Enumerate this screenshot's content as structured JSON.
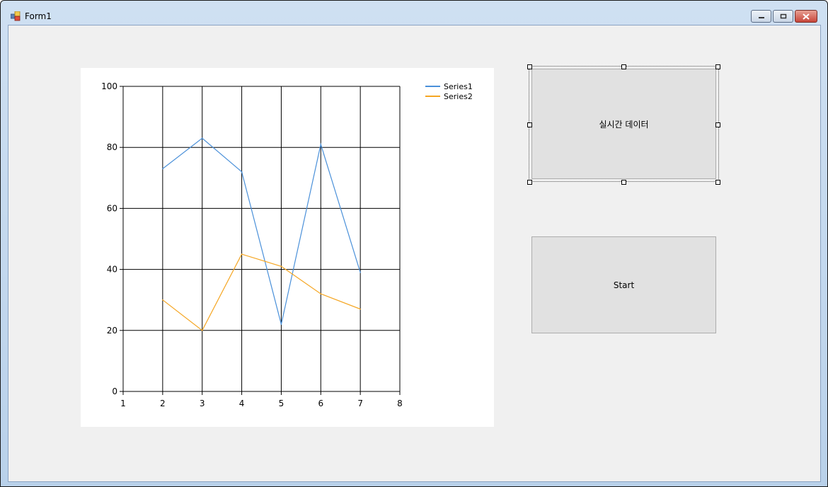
{
  "window": {
    "title": "Form1",
    "icon": "winforms-app-icon"
  },
  "caption_buttons": {
    "minimize": "minimize-icon",
    "maximize": "restore-icon",
    "close": "close-icon"
  },
  "buttons": {
    "realtime_label": "실시간 데이터",
    "start_label": "Start"
  },
  "colors": {
    "series1": "#4a90d9",
    "series2": "#f5a623",
    "client_bg": "#f0f0f0",
    "button_bg": "#e1e1e1"
  },
  "chart_data": {
    "type": "line",
    "xlim": [
      1,
      8
    ],
    "ylim": [
      0,
      100
    ],
    "x_ticks": [
      1,
      2,
      3,
      4,
      5,
      6,
      7,
      8
    ],
    "y_ticks": [
      0,
      20,
      40,
      60,
      80,
      100
    ],
    "grid": true,
    "legend": "top-right",
    "series": [
      {
        "name": "Series1",
        "color": "#4a90d9",
        "x": [
          2,
          3,
          4,
          5,
          6,
          7
        ],
        "y": [
          73,
          83,
          72,
          22,
          81,
          39
        ]
      },
      {
        "name": "Series2",
        "color": "#f5a623",
        "x": [
          2,
          3,
          4,
          5,
          6,
          7
        ],
        "y": [
          30,
          20,
          45,
          41,
          32,
          27
        ]
      }
    ]
  }
}
